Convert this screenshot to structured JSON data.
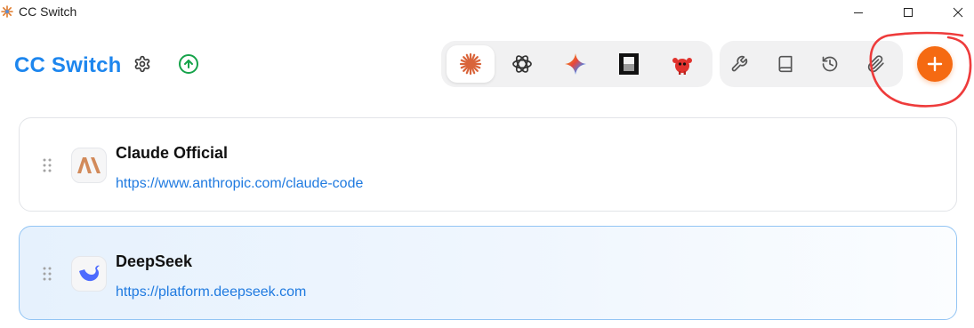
{
  "window": {
    "title": "CC Switch",
    "controls": [
      "minimize",
      "maximize",
      "close"
    ]
  },
  "header": {
    "brand": "CC Switch",
    "settings_icon": "gear-icon",
    "update_icon": "arrow-up-circle-icon"
  },
  "apps": [
    {
      "name": "claude",
      "icon": "claude-icon",
      "active": true
    },
    {
      "name": "codex",
      "icon": "openai-icon",
      "active": false
    },
    {
      "name": "gemini",
      "icon": "gemini-icon",
      "active": false
    },
    {
      "name": "opencode",
      "icon": "opencode-icon",
      "active": false
    },
    {
      "name": "openclaw",
      "icon": "openclaw-icon",
      "active": false
    }
  ],
  "tools": [
    {
      "name": "tools",
      "icon": "wrench-icon"
    },
    {
      "name": "prompts",
      "icon": "book-icon"
    },
    {
      "name": "history",
      "icon": "history-icon"
    },
    {
      "name": "attachments",
      "icon": "paperclip-icon"
    }
  ],
  "add_button_icon": "plus-icon",
  "providers": [
    {
      "name": "Claude Official",
      "url": "https://www.anthropic.com/claude-code",
      "icon": "anthropic-icon",
      "selected": false
    },
    {
      "name": "DeepSeek",
      "url": "https://platform.deepseek.com",
      "icon": "deepseek-icon",
      "selected": true
    }
  ],
  "colors": {
    "brand": "#1d86ee",
    "accent": "#f56a12",
    "update": "#16a34a",
    "link": "#1f7ae0",
    "annotation": "#ee3b3b"
  }
}
